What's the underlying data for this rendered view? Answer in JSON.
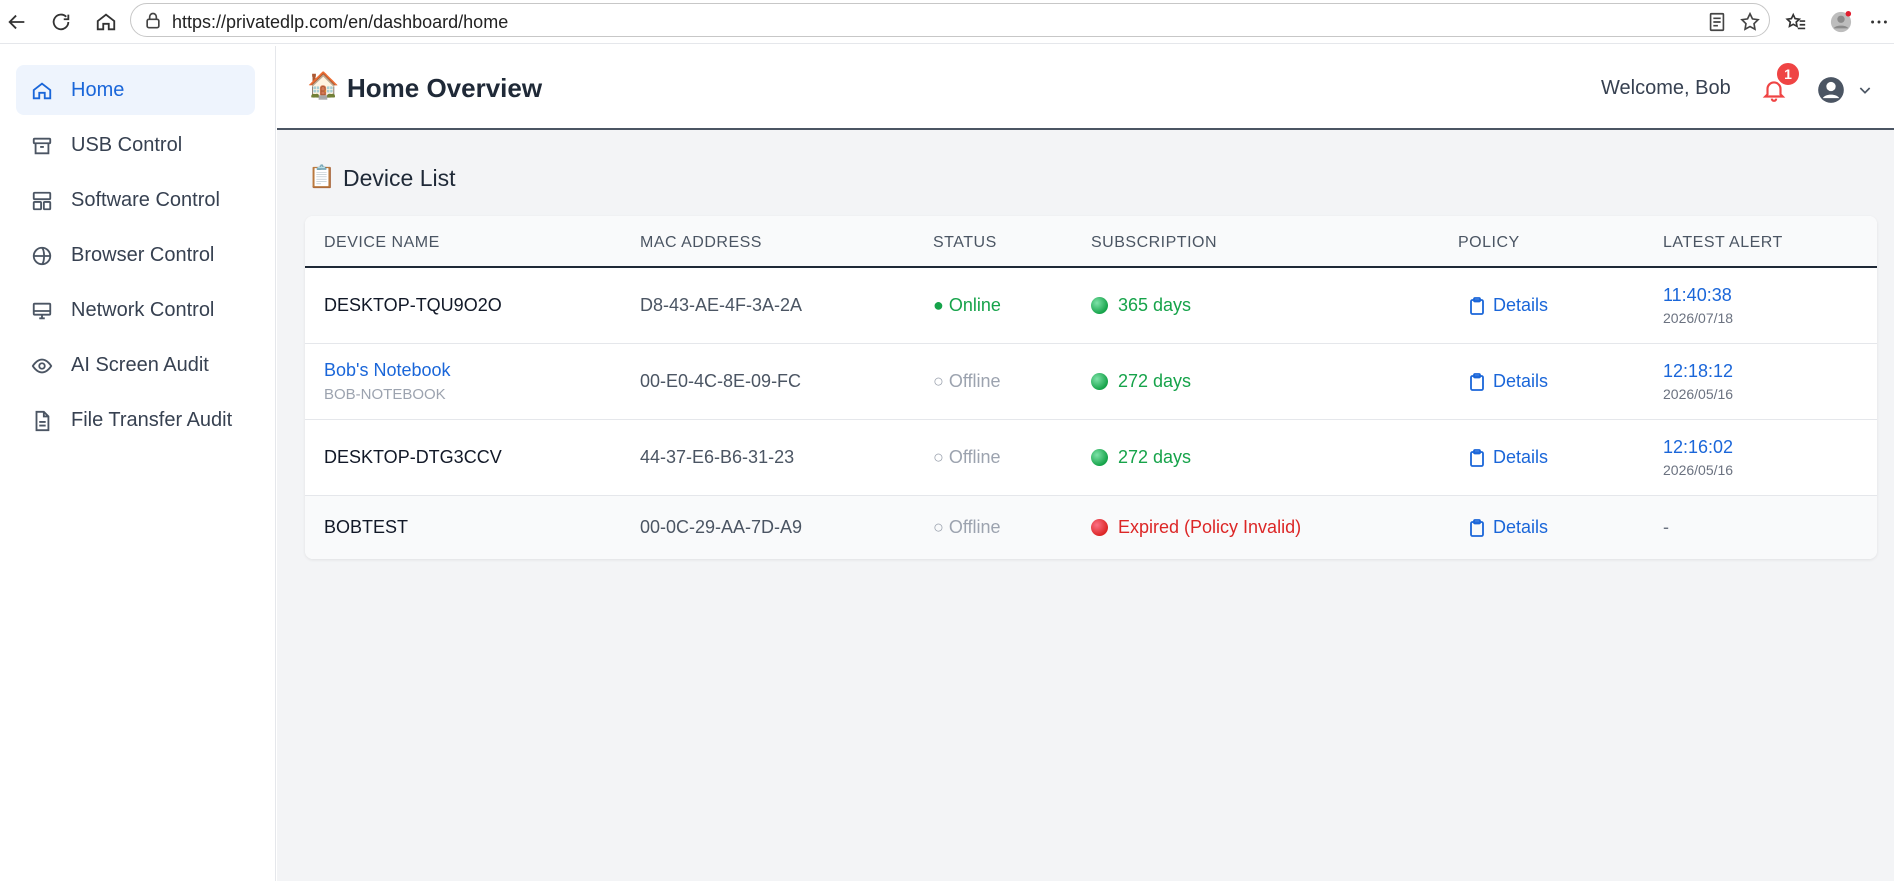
{
  "browser": {
    "url": "https://privatedlp.com/en/dashboard/home"
  },
  "sidebar": {
    "items": [
      {
        "label": "Home",
        "icon": "home-icon",
        "active": true
      },
      {
        "label": "USB Control",
        "icon": "archive-icon"
      },
      {
        "label": "Software Control",
        "icon": "layout-icon"
      },
      {
        "label": "Browser Control",
        "icon": "globe-icon"
      },
      {
        "label": "Network Control",
        "icon": "monitor-icon"
      },
      {
        "label": "AI Screen Audit",
        "icon": "eye-icon"
      },
      {
        "label": "File Transfer Audit",
        "icon": "file-icon"
      }
    ]
  },
  "header": {
    "emoji": "🏠",
    "title": "Home Overview",
    "welcome": "Welcome, Bob",
    "notification_count": "1"
  },
  "section": {
    "emoji": "📋",
    "title": "Device List"
  },
  "table": {
    "columns": [
      "DEVICE NAME",
      "MAC ADDRESS",
      "STATUS",
      "SUBSCRIPTION",
      "POLICY",
      "LATEST ALERT"
    ],
    "rows": [
      {
        "name": "DESKTOP-TQU9O2O",
        "hostname": "",
        "mac": "D8-43-AE-4F-3A-2A",
        "status": "● Online",
        "subscription": "365 days",
        "policy": "Details",
        "alert_time": "11:40:38",
        "alert_date": "2026/07/18"
      },
      {
        "name": "Bob's Notebook",
        "hostname": "BOB-NOTEBOOK",
        "mac": "00-E0-4C-8E-09-FC",
        "status": "○ Offline",
        "subscription": "272 days",
        "policy": "Details",
        "alert_time": "12:18:12",
        "alert_date": "2026/05/16"
      },
      {
        "name": "DESKTOP-DTG3CCV",
        "hostname": "",
        "mac": "44-37-E6-B6-31-23",
        "status": "○ Offline",
        "subscription": "272 days",
        "policy": "Details",
        "alert_time": "12:16:02",
        "alert_date": "2026/05/16"
      },
      {
        "name": "BOBTEST",
        "hostname": "",
        "mac": "00-0C-29-AA-7D-A9",
        "status": "○ Offline",
        "subscription": "Expired (Policy Invalid)",
        "policy": "Details",
        "alert_time": "",
        "alert_date": "",
        "alert_none": "-"
      }
    ]
  },
  "colors": {
    "accent": "#1a66d9",
    "online": "#16a34a",
    "expired": "#dc2626",
    "badge": "#ef4444"
  }
}
